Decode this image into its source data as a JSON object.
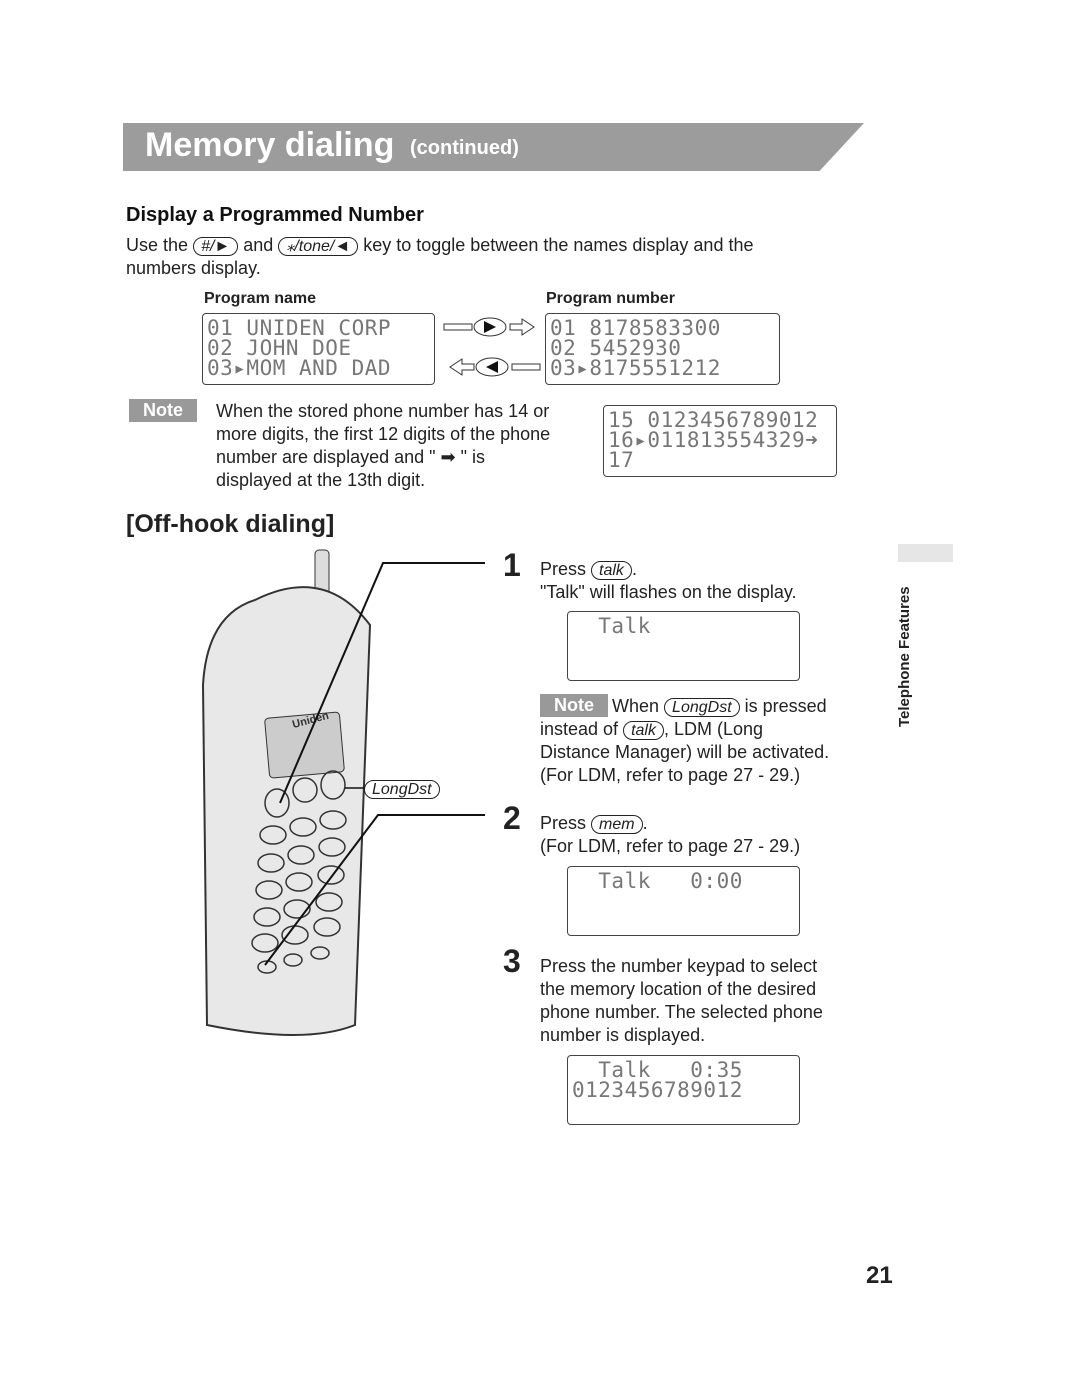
{
  "header": {
    "title": "Memory dialing",
    "subtitle": "(continued)"
  },
  "section1": {
    "heading": "Display a Programmed Number",
    "text_before": "Use the",
    "key1": "#/►",
    "text_and": "and",
    "key2": "⁎/tone/◄",
    "text_after": "key to toggle between the names display and the",
    "text_line2": "numbers display.",
    "label_name": "Program name",
    "label_number": "Program number",
    "lcd_names": "01 UNIDEN CORP\n02 JOHN DOE\n03▸MOM AND DAD",
    "lcd_numbers": "01 8178583300\n02 5452930\n03▸8175551212",
    "right_arrow_key": "►",
    "left_arrow_key": "◄",
    "note_label": "Note",
    "note_lines": [
      "When the stored phone number has 14 or",
      "more digits, the first 12 digits of the phone",
      "number are displayed and \" ➡ \" is",
      "displayed at the 13th digit."
    ],
    "lcd_long": "15 0123456789012\n16▸011813554329➜\n17"
  },
  "section2": {
    "heading": "[Off-hook dialing]",
    "phone_brand": "Uniden",
    "longdst_label": "LongDst",
    "steps": [
      {
        "num": "1",
        "press": "Press",
        "key": "talk",
        "line2": "\"Talk\" will flashes on the display.",
        "lcd": "  Talk"
      },
      {
        "num": "2",
        "press": "Press",
        "key": "mem",
        "line2": "(For LDM, refer to page 27 - 29.)",
        "lcd": "  Talk   0:00"
      },
      {
        "num": "3",
        "lines": [
          "Press the number keypad to select",
          "the memory location of the desired",
          "phone number. The selected phone",
          "number is displayed."
        ],
        "lcd": "  Talk   0:35\n0123456789012"
      }
    ],
    "note": {
      "label": "Note",
      "when": "When",
      "key1": "LongDst",
      "pressed": "is pressed",
      "instead": "instead of",
      "key2": "talk",
      "rest1": ", LDM (Long",
      "rest2": "Distance Manager) will be activated.",
      "rest3": "(For LDM, refer to page 27 - 29.)"
    }
  },
  "side_tab": "Telephone Features",
  "page_number": "21"
}
